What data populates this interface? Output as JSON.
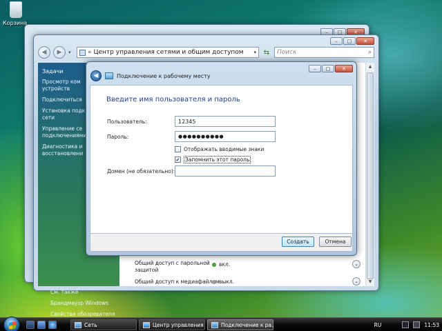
{
  "desktop": {
    "recycle_bin_label": "Корзина"
  },
  "explorer": {
    "address_path": "Центр управления сетями и общим доступом",
    "search_placeholder": "Поиск",
    "sidebar": {
      "header": "Задачи",
      "links": [
        "Просмотр ком\nустройств",
        "Подключиться",
        "Установка подк\nсети",
        "Управление се\nподключениями",
        "Диагностика и\nвосстановлени"
      ],
      "see_also": "См. также",
      "bottom_links": [
        "Брандмауэр Windows",
        "Свойства обозревателя"
      ]
    },
    "sharing": [
      {
        "label": "Общий доступ с парольной\nзащитой",
        "value": "вкл.",
        "color": "#3da52c"
      },
      {
        "label": "Общий доступ к медиафайлам",
        "value": "выкл.",
        "color": "#8a8a8a"
      }
    ]
  },
  "dialog": {
    "title": "Подключение к рабочему месту",
    "heading": "Введите имя пользователя и пароль",
    "user_label": "Пользователь:",
    "user_value": "12345",
    "password_label": "Пароль:",
    "password_value": "●●●●●●●●●●",
    "show_chars_label": "Отображать вводимые знаки",
    "show_chars_checked": false,
    "remember_label": "Запомнить этот пароль",
    "remember_checked": true,
    "domain_label": "Домен (не обязательно):",
    "domain_value": "",
    "create_button": "Создать",
    "cancel_button": "Отмена"
  },
  "taskbar": {
    "tasks": [
      {
        "label": "Сеть",
        "active": false
      },
      {
        "label": "Центр управления ...",
        "active": false
      },
      {
        "label": "Подключение к ра...",
        "active": true
      }
    ],
    "language": "RU",
    "clock": "11:53"
  },
  "colors": {
    "heading_blue": "#1a3e8c",
    "accent": "#3c7fb1"
  }
}
